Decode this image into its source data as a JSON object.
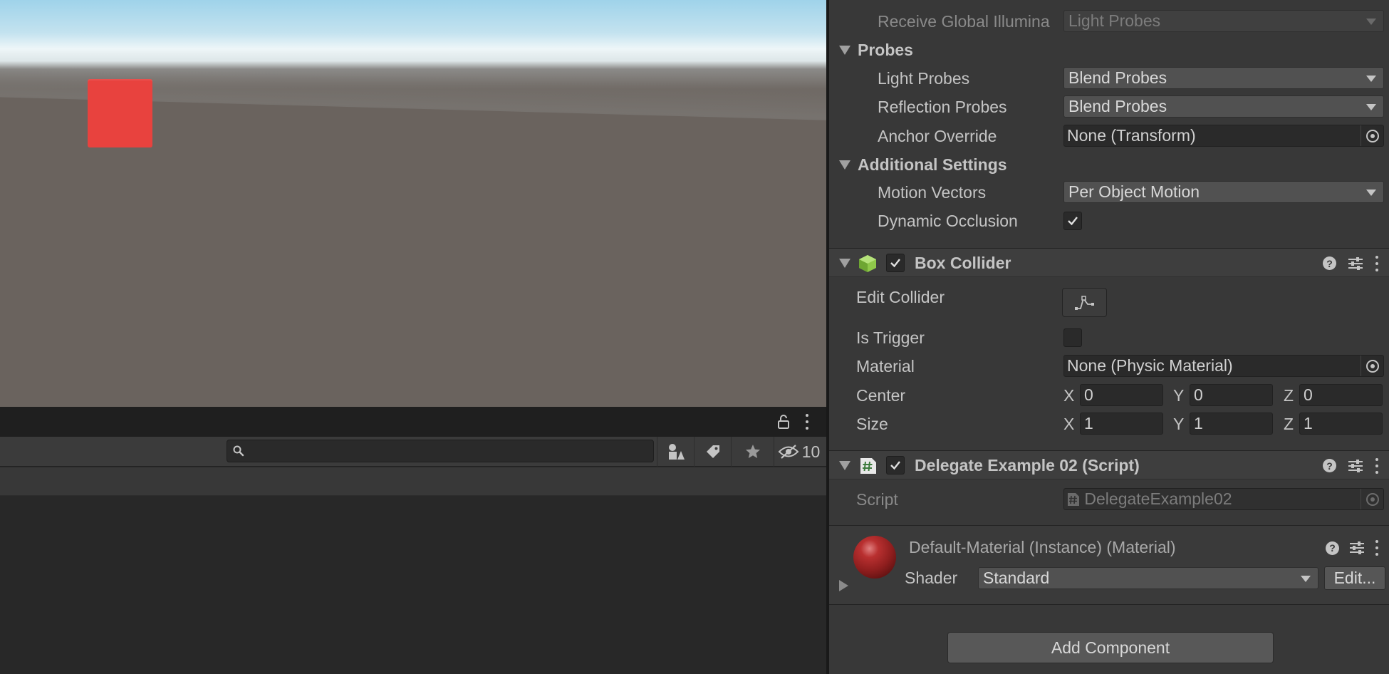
{
  "hierarchy": {
    "search": {
      "value": "",
      "placeholder": ""
    },
    "hidden_count": "10"
  },
  "inspector": {
    "mesh_renderer": {
      "receive_gi": {
        "label": "Receive Global Illumina",
        "value": "Light Probes"
      },
      "probes": {
        "title": "Probes",
        "light_probes": {
          "label": "Light Probes",
          "value": "Blend Probes"
        },
        "reflection_probes": {
          "label": "Reflection Probes",
          "value": "Blend Probes"
        },
        "anchor_override": {
          "label": "Anchor Override",
          "value": "None (Transform)"
        }
      },
      "additional": {
        "title": "Additional Settings",
        "motion_vectors": {
          "label": "Motion Vectors",
          "value": "Per Object Motion"
        },
        "dynamic_occlusion": {
          "label": "Dynamic Occlusion",
          "checked": true
        }
      }
    },
    "box_collider": {
      "title": "Box Collider",
      "enabled": true,
      "edit_collider": {
        "label": "Edit Collider"
      },
      "is_trigger": {
        "label": "Is Trigger",
        "checked": false
      },
      "material": {
        "label": "Material",
        "value": "None (Physic Material)"
      },
      "center": {
        "label": "Center",
        "x_label": "X",
        "y_label": "Y",
        "z_label": "Z",
        "x": "0",
        "y": "0",
        "z": "0"
      },
      "size": {
        "label": "Size",
        "x_label": "X",
        "y_label": "Y",
        "z_label": "Z",
        "x": "1",
        "y": "1",
        "z": "1"
      }
    },
    "script_component": {
      "title": "Delegate Example 02 (Script)",
      "enabled": true,
      "script": {
        "label": "Script",
        "value": "DelegateExample02"
      }
    },
    "material": {
      "title": "Default-Material (Instance) (Material)",
      "shader": {
        "label": "Shader",
        "value": "Standard"
      },
      "edit_label": "Edit..."
    },
    "add_component_label": "Add Component"
  },
  "colors": {
    "cube": "#e8423e",
    "inspector_bg": "#383838",
    "panel_dark": "#282828",
    "collider_icon": "#8fc84a"
  },
  "icons": [
    "lock-icon",
    "search-icon",
    "scene-visibility-icon",
    "tag-icon",
    "star-icon",
    "eye-hidden-icon",
    "help-icon",
    "presets-icon",
    "kebab-icon",
    "box-collider-icon",
    "script-icon",
    "object-picker-icon",
    "edit-collider-icon"
  ]
}
